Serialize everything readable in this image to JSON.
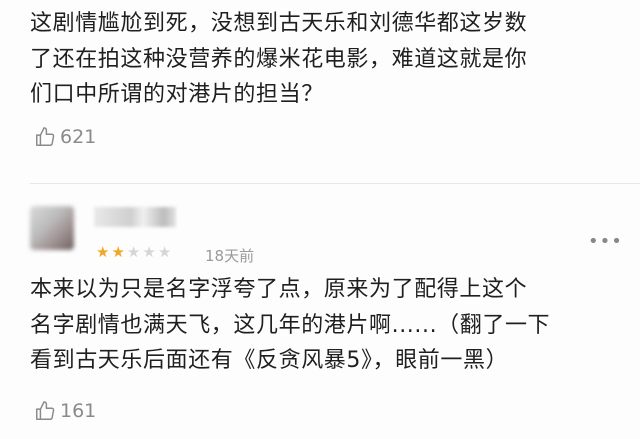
{
  "comments": [
    {
      "text_lines": [
        "这剧情尴尬到死，没想到古天乐和刘德华都这岁数",
        "了还在拍这种没营养的爆米花电影，难道这就是你",
        "们口中所谓的对港片的担当？"
      ],
      "likes": "621"
    },
    {
      "rating": 2,
      "rating_max": 5,
      "date": "18天前",
      "text_lines": [
        "本来以为只是名字浮夸了点，原来为了配得上这个",
        "名字剧情也满天飞，这几年的港片啊......（翻了一下",
        "看到古天乐后面还有《反贪风暴5》，眼前一黑）"
      ],
      "likes": "161"
    }
  ],
  "icons": {
    "like": "thumbs-up-icon",
    "more": "more-icon",
    "star": "star-icon"
  },
  "colors": {
    "star_filled": "#f0a828",
    "star_empty": "#d6d6d6",
    "muted_text": "#8a8a8a"
  }
}
